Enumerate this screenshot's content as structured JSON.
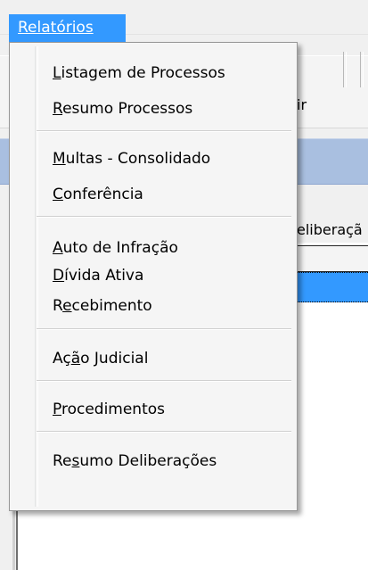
{
  "menubar": {
    "active_menu": "Relatórios"
  },
  "background": {
    "toolbar_fragment": "ir",
    "tab_fragment": "eliberaçã"
  },
  "dropdown": {
    "items": [
      {
        "mnemonic": "L",
        "rest": "istagem de Processos"
      },
      {
        "mnemonic": "R",
        "rest": "esumo Processos"
      },
      {
        "mnemonic": "M",
        "rest": "ultas - Consolidado"
      },
      {
        "mnemonic": "C",
        "rest": "onferência"
      },
      {
        "mnemonic": "A",
        "rest": "uto de Infração"
      },
      {
        "mnemonic": "D",
        "rest": "ívida Ativa"
      },
      {
        "pre": "R",
        "mnemonic": "e",
        "rest": "cebimento"
      },
      {
        "pre": "Aç",
        "mnemonic": "ã",
        "rest": "o Judicial"
      },
      {
        "mnemonic": "P",
        "rest": "rocedimentos"
      },
      {
        "pre": "Re",
        "mnemonic": "s",
        "rest": "umo Deliberações"
      }
    ]
  }
}
